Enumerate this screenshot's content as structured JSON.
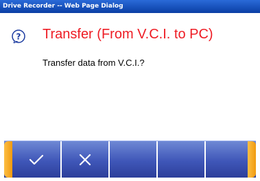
{
  "window": {
    "title": "Drive Recorder -- Web Page Dialog"
  },
  "dialog": {
    "icon": "question-icon",
    "title": "Transfer (From V.C.I. to PC)",
    "message": "Transfer data from V.C.I.?"
  },
  "toolbar": {
    "buttons": [
      {
        "name": "confirm-button",
        "icon": "checkmark-icon"
      },
      {
        "name": "cancel-button",
        "icon": "cross-icon"
      },
      {
        "name": "toolbar-button-3",
        "icon": ""
      },
      {
        "name": "toolbar-button-4",
        "icon": ""
      },
      {
        "name": "toolbar-button-5",
        "icon": ""
      }
    ]
  },
  "colors": {
    "title_text": "#ee1c24",
    "titlebar": "#1650c4",
    "toolbar": "#4a62c4",
    "toolbar_cap": "#f5a623"
  }
}
